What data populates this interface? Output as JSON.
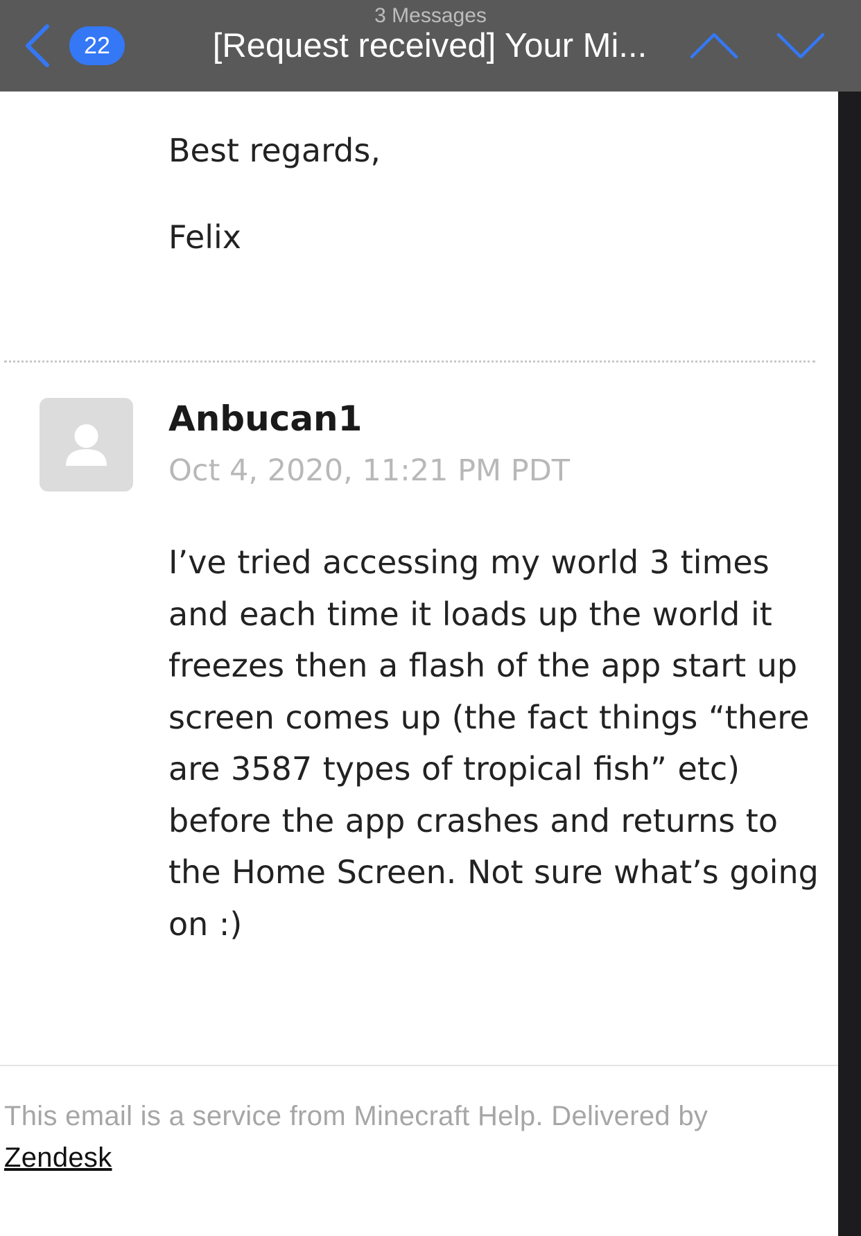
{
  "header": {
    "message_count": "3 Messages",
    "unread_badge": "22",
    "subject": "[Request received] Your Mi...",
    "icons": {
      "back": "chevron-left-icon",
      "previous": "chevron-up-icon",
      "next": "chevron-down-icon"
    },
    "accent_color": "#3478f6"
  },
  "previous_message": {
    "closing": "Best regards,",
    "signature": "Felix"
  },
  "message": {
    "sender": "Anbucan1",
    "timestamp": "Oct 4, 2020, 11:21 PM PDT",
    "avatar_icon": "person-icon",
    "body": "I’ve tried accessing my world 3 times and each time it loads up the world it freezes then a flash of the app start up screen comes up (the fact things “there are 3587 types of tropical fish” etc) before the app crashes and returns to the Home Screen. Not sure what’s going on :)"
  },
  "footer": {
    "text": "This email is a service from Minecraft Help. Delivered by",
    "link": "Zendesk"
  }
}
